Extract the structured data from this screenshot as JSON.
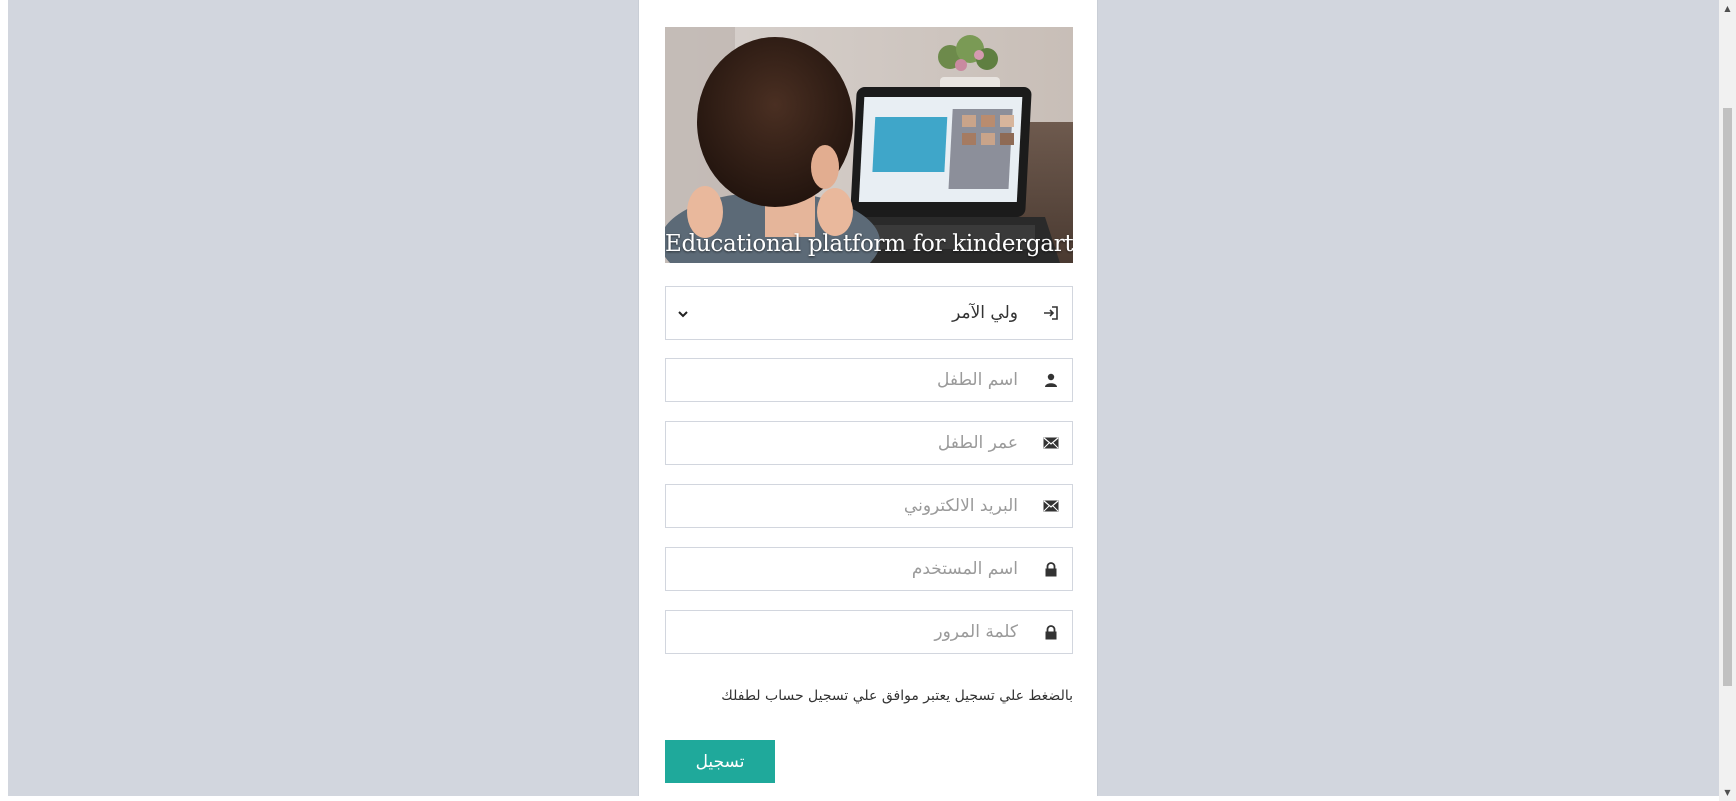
{
  "hero": {
    "caption": "Educational platform for kindergarten"
  },
  "form": {
    "role_select": {
      "selected": "ولي الآمر",
      "icon": "sign-in-icon"
    },
    "fields": [
      {
        "placeholder": "اسم الطفل",
        "icon": "user-icon"
      },
      {
        "placeholder": "عمر الطفل",
        "icon": "envelope-icon"
      },
      {
        "placeholder": "البريد الالكتروني",
        "icon": "envelope-icon"
      },
      {
        "placeholder": "اسم المستخدم",
        "icon": "lock-icon"
      },
      {
        "placeholder": "كلمة المرور",
        "icon": "lock-icon"
      }
    ],
    "note": "بالضغط علي تسجيل يعتبر موافق علي تسجيل حساب لطفلك",
    "submit_label": "تسجيل"
  },
  "colors": {
    "page_background": "#d2d6de",
    "button": "#1fa99b"
  }
}
